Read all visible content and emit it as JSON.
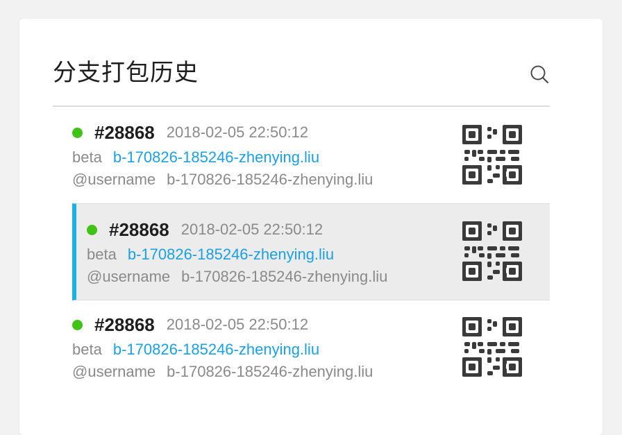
{
  "header": {
    "title": "分支打包历史",
    "search_icon": "search-icon"
  },
  "builds": [
    {
      "dot_color": "#3fc315",
      "number": "#28868",
      "time": "2018-02-05 22:50:12",
      "env": "beta",
      "branch": "b-170826-185246-zhenying.liu",
      "user": "@username",
      "commit": "b-170826-185246-zhenying.liu",
      "selected": false
    },
    {
      "dot_color": "#3fc315",
      "number": "#28868",
      "time": "2018-02-05 22:50:12",
      "env": "beta",
      "branch": "b-170826-185246-zhenying.liu",
      "user": "@username",
      "commit": "b-170826-185246-zhenying.liu",
      "selected": true
    },
    {
      "dot_color": "#3fc315",
      "number": "#28868",
      "time": "2018-02-05 22:50:12",
      "env": "beta",
      "branch": "b-170826-185246-zhenying.liu",
      "user": "@username",
      "commit": "b-170826-185246-zhenying.liu",
      "selected": false
    }
  ],
  "colors": {
    "accent": "#1ab2e6",
    "link": "#1aa0e8",
    "status_ok": "#3fc315"
  }
}
